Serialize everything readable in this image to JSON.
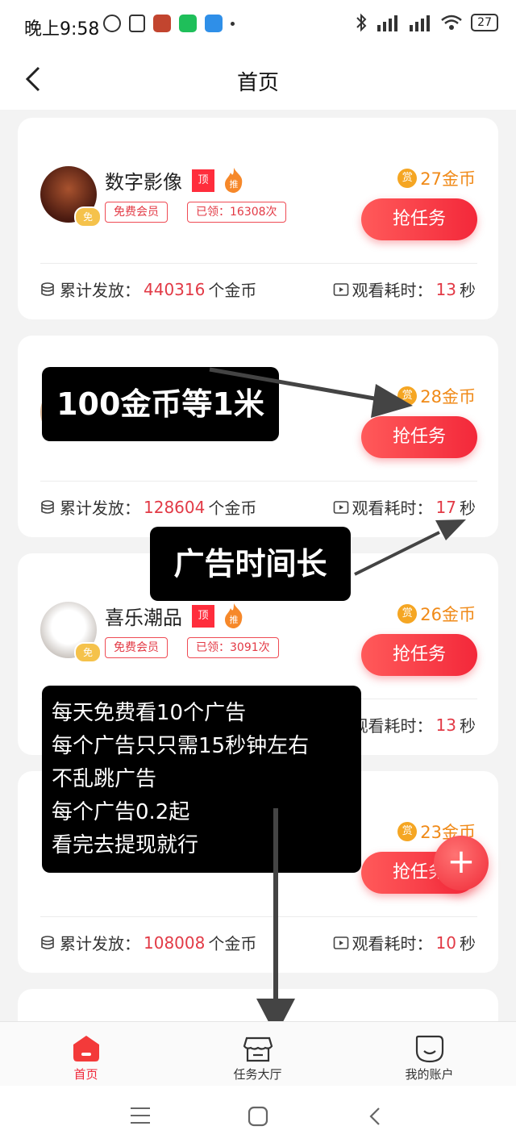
{
  "status_bar": {
    "time": "晚上9:58",
    "battery": "27"
  },
  "header": {
    "title": "首页"
  },
  "cards": [
    {
      "name": "数字影像",
      "tag_top": "顶",
      "tag_hot": "推",
      "member_label": "免费会员",
      "claimed": "已领：16308次",
      "reward_icon": "赏",
      "reward": "27金币",
      "button": "抢任务",
      "total_label": "累计发放：",
      "total_value": "440316",
      "total_unit": "个金币",
      "time_label": "观看耗时：",
      "time_value": "13",
      "time_unit": "秒"
    },
    {
      "reward_icon": "赏",
      "reward": "28金币",
      "button": "抢任务",
      "total_label": "累计发放：",
      "total_value": "128604",
      "total_unit": "个金币",
      "time_label": "观看耗时：",
      "time_value": "17",
      "time_unit": "秒"
    },
    {
      "name": "喜乐潮品",
      "tag_top": "顶",
      "tag_hot": "推",
      "member_label": "免费会员",
      "claimed": "已领：3091次",
      "reward_icon": "赏",
      "reward": "26金币",
      "button": "抢任务",
      "time_label": "观看耗时：",
      "time_value": "13",
      "time_unit": "秒"
    },
    {
      "reward_icon": "赏",
      "reward": "23金币",
      "button": "抢任务",
      "total_label": "累计发放：",
      "total_value": "108008",
      "total_unit": "个金币",
      "time_label": "观看耗时：",
      "time_value": "10",
      "time_unit": "秒"
    }
  ],
  "annotations": {
    "a1": "100金币等1米",
    "a2": "广告时间长",
    "a3": [
      "每天免费看10个广告",
      "每个广告只只需15秒钟左右",
      "不乱跳广告",
      "每个广告0.2起",
      "看完去提现就行"
    ]
  },
  "badge_avatar": "免",
  "fab": "+",
  "tabbar": [
    {
      "label": "首页",
      "icon": "home-icon"
    },
    {
      "label": "任务大厅",
      "icon": "store-icon"
    },
    {
      "label": "我的账户",
      "icon": "profile-icon"
    }
  ],
  "colors": {
    "accent": "#f3283a",
    "reward": "#f08a18",
    "number": "#e23a46"
  }
}
